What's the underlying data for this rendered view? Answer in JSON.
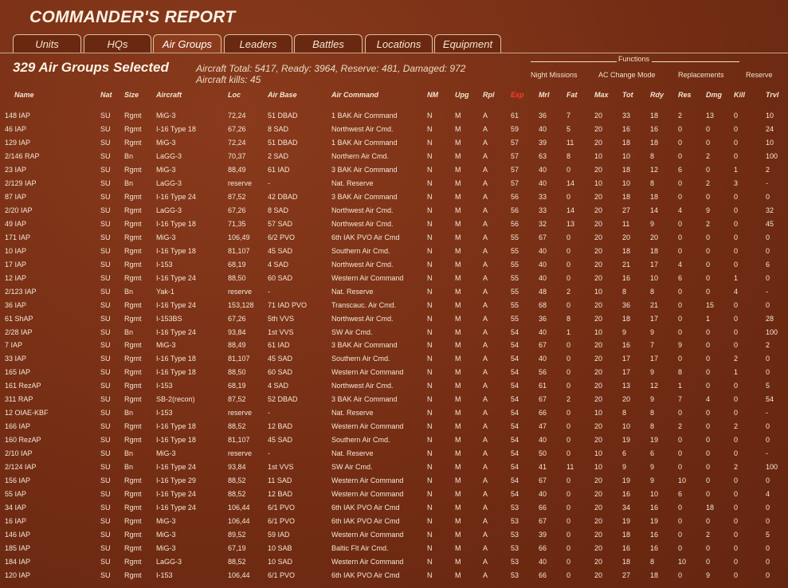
{
  "title": "COMMANDER'S REPORT",
  "tabs": [
    {
      "label": "Units",
      "active": false
    },
    {
      "label": "HQs",
      "active": false
    },
    {
      "label": "Air Groups",
      "active": true
    },
    {
      "label": "Leaders",
      "active": false
    },
    {
      "label": "Battles",
      "active": false
    },
    {
      "label": "Locations",
      "active": false
    },
    {
      "label": "Equipment",
      "active": false
    }
  ],
  "summary": {
    "selected": "329 Air Groups Selected",
    "totals_line1": "Aircraft Total: 5417, Ready: 3964, Reserve: 481, Damaged: 972",
    "totals_line2": "Aircraft kills: 45"
  },
  "functions": {
    "label": "Functions",
    "items": [
      "Night Missions",
      "AC Change Mode",
      "Replacements",
      "Reserve"
    ]
  },
  "columns": [
    "Name",
    "Nat",
    "Size",
    "Aircraft",
    "Loc",
    "Air Base",
    "Air Command",
    "NM",
    "Upg",
    "Rpl",
    "Exp",
    "Mrl",
    "Fat",
    "Max",
    "Tot",
    "Rdy",
    "Res",
    "Dmg",
    "Kill",
    "Trvl"
  ],
  "sort_column": "Exp",
  "colors": {
    "background": "#7a3016",
    "sort_header": "#ff3a2a",
    "text": "#f3e7d8"
  },
  "rows": [
    [
      "148 IAP",
      "SU",
      "Rgmt",
      "MiG-3",
      "72,24",
      "51 DBAD",
      "1 BAK Air Command",
      "N",
      "M",
      "A",
      "61",
      "36",
      "7",
      "20",
      "33",
      "18",
      "2",
      "13",
      "0",
      "10"
    ],
    [
      "46 IAP",
      "SU",
      "Rgmt",
      "I-16 Type 18",
      "67,26",
      "8 SAD",
      "Northwest Air Cmd.",
      "N",
      "M",
      "A",
      "59",
      "40",
      "5",
      "20",
      "16",
      "16",
      "0",
      "0",
      "0",
      "24"
    ],
    [
      "129 IAP",
      "SU",
      "Rgmt",
      "MiG-3",
      "72,24",
      "51 DBAD",
      "1 BAK Air Command",
      "N",
      "M",
      "A",
      "57",
      "39",
      "11",
      "20",
      "18",
      "18",
      "0",
      "0",
      "0",
      "10"
    ],
    [
      "2/146 RAP",
      "SU",
      "Bn",
      "LaGG-3",
      "70,37",
      "2 SAD",
      "Northern Air Cmd.",
      "N",
      "M",
      "A",
      "57",
      "63",
      "8",
      "10",
      "10",
      "8",
      "0",
      "2",
      "0",
      "100"
    ],
    [
      "23 IAP",
      "SU",
      "Rgmt",
      "MiG-3",
      "88,49",
      "61 IAD",
      "3 BAK Air Command",
      "N",
      "M",
      "A",
      "57",
      "40",
      "0",
      "20",
      "18",
      "12",
      "6",
      "0",
      "1",
      "2"
    ],
    [
      "2/129 IAP",
      "SU",
      "Bn",
      "LaGG-3",
      "reserve",
      "-",
      "Nat. Reserve",
      "N",
      "M",
      "A",
      "57",
      "40",
      "14",
      "10",
      "10",
      "8",
      "0",
      "2",
      "3",
      "-"
    ],
    [
      "87 IAP",
      "SU",
      "Rgmt",
      "I-16 Type 24",
      "87,52",
      "42 DBAD",
      "3 BAK Air Command",
      "N",
      "M",
      "A",
      "56",
      "33",
      "0",
      "20",
      "18",
      "18",
      "0",
      "0",
      "0",
      "0"
    ],
    [
      "2/20 IAP",
      "SU",
      "Rgmt",
      "LaGG-3",
      "67,26",
      "8 SAD",
      "Northwest Air Cmd.",
      "N",
      "M",
      "A",
      "56",
      "33",
      "14",
      "20",
      "27",
      "14",
      "4",
      "9",
      "0",
      "32"
    ],
    [
      "49 IAP",
      "SU",
      "Rgmt",
      "I-16 Type 18",
      "71,35",
      "57 SAD",
      "Northwest Air Cmd.",
      "N",
      "M",
      "A",
      "56",
      "32",
      "13",
      "20",
      "11",
      "9",
      "0",
      "2",
      "0",
      "45"
    ],
    [
      "171 IAP",
      "SU",
      "Rgmt",
      "MiG-3",
      "106,49",
      "6/2 PVO",
      "6th IAK PVO Air Cmd",
      "N",
      "M",
      "A",
      "55",
      "67",
      "0",
      "20",
      "20",
      "20",
      "0",
      "0",
      "0",
      "0"
    ],
    [
      "10 IAP",
      "SU",
      "Rgmt",
      "I-16 Type 18",
      "81,107",
      "45 SAD",
      "Southern Air Cmd.",
      "N",
      "M",
      "A",
      "55",
      "40",
      "0",
      "20",
      "18",
      "18",
      "0",
      "0",
      "0",
      "0"
    ],
    [
      "17 IAP",
      "SU",
      "Rgmt",
      "I-153",
      "68,19",
      "4 SAD",
      "Northwest Air Cmd.",
      "N",
      "M",
      "A",
      "55",
      "40",
      "0",
      "20",
      "21",
      "17",
      "4",
      "0",
      "0",
      "6"
    ],
    [
      "12 IAP",
      "SU",
      "Rgmt",
      "I-16 Type 24",
      "88,50",
      "60 SAD",
      "Western Air Command",
      "N",
      "M",
      "A",
      "55",
      "40",
      "0",
      "20",
      "16",
      "10",
      "6",
      "0",
      "1",
      "0"
    ],
    [
      "2/123 IAP",
      "SU",
      "Bn",
      "Yak-1",
      "reserve",
      "-",
      "Nat. Reserve",
      "N",
      "M",
      "A",
      "55",
      "48",
      "2",
      "10",
      "8",
      "8",
      "0",
      "0",
      "4",
      "-"
    ],
    [
      "36 IAP",
      "SU",
      "Rgmt",
      "I-16 Type 24",
      "153,128",
      "71 IAD PVO",
      "Transcauc. Air Cmd.",
      "N",
      "M",
      "A",
      "55",
      "68",
      "0",
      "20",
      "36",
      "21",
      "0",
      "15",
      "0",
      "0"
    ],
    [
      "61 ShAP",
      "SU",
      "Rgmt",
      "I-153BS",
      "67,26",
      "5th VVS",
      "Northwest Air Cmd.",
      "N",
      "M",
      "A",
      "55",
      "36",
      "8",
      "20",
      "18",
      "17",
      "0",
      "1",
      "0",
      "28"
    ],
    [
      "2/28 IAP",
      "SU",
      "Bn",
      "I-16 Type 24",
      "93,84",
      "1st VVS",
      "SW Air Cmd.",
      "N",
      "M",
      "A",
      "54",
      "40",
      "1",
      "10",
      "9",
      "9",
      "0",
      "0",
      "0",
      "100"
    ],
    [
      "7 IAP",
      "SU",
      "Rgmt",
      "MiG-3",
      "88,49",
      "61 IAD",
      "3 BAK Air Command",
      "N",
      "M",
      "A",
      "54",
      "67",
      "0",
      "20",
      "16",
      "7",
      "9",
      "0",
      "0",
      "2"
    ],
    [
      "33 IAP",
      "SU",
      "Rgmt",
      "I-16 Type 18",
      "81,107",
      "45 SAD",
      "Southern Air Cmd.",
      "N",
      "M",
      "A",
      "54",
      "40",
      "0",
      "20",
      "17",
      "17",
      "0",
      "0",
      "2",
      "0"
    ],
    [
      "165 IAP",
      "SU",
      "Rgmt",
      "I-16 Type 18",
      "88,50",
      "60 SAD",
      "Western Air Command",
      "N",
      "M",
      "A",
      "54",
      "56",
      "0",
      "20",
      "17",
      "9",
      "8",
      "0",
      "1",
      "0"
    ],
    [
      "161 RezAP",
      "SU",
      "Rgmt",
      "I-153",
      "68,19",
      "4 SAD",
      "Northwest Air Cmd.",
      "N",
      "M",
      "A",
      "54",
      "61",
      "0",
      "20",
      "13",
      "12",
      "1",
      "0",
      "0",
      "5"
    ],
    [
      "311 RAP",
      "SU",
      "Rgmt",
      "SB-2(recon)",
      "87,52",
      "52 DBAD",
      "3 BAK Air Command",
      "N",
      "M",
      "A",
      "54",
      "67",
      "2",
      "20",
      "20",
      "9",
      "7",
      "4",
      "0",
      "54"
    ],
    [
      "12 OIAE-KBF",
      "SU",
      "Bn",
      "I-153",
      "reserve",
      "-",
      "Nat. Reserve",
      "N",
      "M",
      "A",
      "54",
      "66",
      "0",
      "10",
      "8",
      "8",
      "0",
      "0",
      "0",
      "-"
    ],
    [
      "166 IAP",
      "SU",
      "Rgmt",
      "I-16 Type 18",
      "88,52",
      "12 BAD",
      "Western Air Command",
      "N",
      "M",
      "A",
      "54",
      "47",
      "0",
      "20",
      "10",
      "8",
      "2",
      "0",
      "2",
      "0"
    ],
    [
      "160 RezAP",
      "SU",
      "Rgmt",
      "I-16 Type 18",
      "81,107",
      "45 SAD",
      "Southern Air Cmd.",
      "N",
      "M",
      "A",
      "54",
      "40",
      "0",
      "20",
      "19",
      "19",
      "0",
      "0",
      "0",
      "0"
    ],
    [
      "2/10 IAP",
      "SU",
      "Bn",
      "MiG-3",
      "reserve",
      "-",
      "Nat. Reserve",
      "N",
      "M",
      "A",
      "54",
      "50",
      "0",
      "10",
      "6",
      "6",
      "0",
      "0",
      "0",
      "-"
    ],
    [
      "2/124 IAP",
      "SU",
      "Bn",
      "I-16 Type 24",
      "93,84",
      "1st VVS",
      "SW Air Cmd.",
      "N",
      "M",
      "A",
      "54",
      "41",
      "11",
      "10",
      "9",
      "9",
      "0",
      "0",
      "2",
      "100"
    ],
    [
      "156 IAP",
      "SU",
      "Rgmt",
      "I-16 Type 29",
      "88,52",
      "11 SAD",
      "Western Air Command",
      "N",
      "M",
      "A",
      "54",
      "67",
      "0",
      "20",
      "19",
      "9",
      "10",
      "0",
      "0",
      "0"
    ],
    [
      "55 IAP",
      "SU",
      "Rgmt",
      "I-16 Type 24",
      "88,52",
      "12 BAD",
      "Western Air Command",
      "N",
      "M",
      "A",
      "54",
      "40",
      "0",
      "20",
      "16",
      "10",
      "6",
      "0",
      "0",
      "4"
    ],
    [
      "34 IAP",
      "SU",
      "Rgmt",
      "I-16 Type 24",
      "106,44",
      "6/1 PVO",
      "6th IAK PVO Air Cmd",
      "N",
      "M",
      "A",
      "53",
      "66",
      "0",
      "20",
      "34",
      "16",
      "0",
      "18",
      "0",
      "0"
    ],
    [
      "16 IAP",
      "SU",
      "Rgmt",
      "MiG-3",
      "106,44",
      "6/1 PVO",
      "6th IAK PVO Air Cmd",
      "N",
      "M",
      "A",
      "53",
      "67",
      "0",
      "20",
      "19",
      "19",
      "0",
      "0",
      "0",
      "0"
    ],
    [
      "146 IAP",
      "SU",
      "Rgmt",
      "MiG-3",
      "89,52",
      "59 IAD",
      "Western Air Command",
      "N",
      "M",
      "A",
      "53",
      "39",
      "0",
      "20",
      "18",
      "16",
      "0",
      "2",
      "0",
      "5"
    ],
    [
      "185 IAP",
      "SU",
      "Rgmt",
      "MiG-3",
      "67,19",
      "10 SAB",
      "Baltic Flt Air Cmd.",
      "N",
      "M",
      "A",
      "53",
      "66",
      "0",
      "20",
      "16",
      "16",
      "0",
      "0",
      "0",
      "0"
    ],
    [
      "184 IAP",
      "SU",
      "Rgmt",
      "LaGG-3",
      "88,52",
      "10 SAD",
      "Western Air Command",
      "N",
      "M",
      "A",
      "53",
      "40",
      "0",
      "20",
      "18",
      "8",
      "10",
      "0",
      "0",
      "0"
    ],
    [
      "120 IAP",
      "SU",
      "Rgmt",
      "I-153",
      "106,44",
      "6/1 PVO",
      "6th IAK PVO Air Cmd",
      "N",
      "M",
      "A",
      "53",
      "66",
      "0",
      "20",
      "27",
      "18",
      "0",
      "9",
      "0",
      "0"
    ]
  ]
}
